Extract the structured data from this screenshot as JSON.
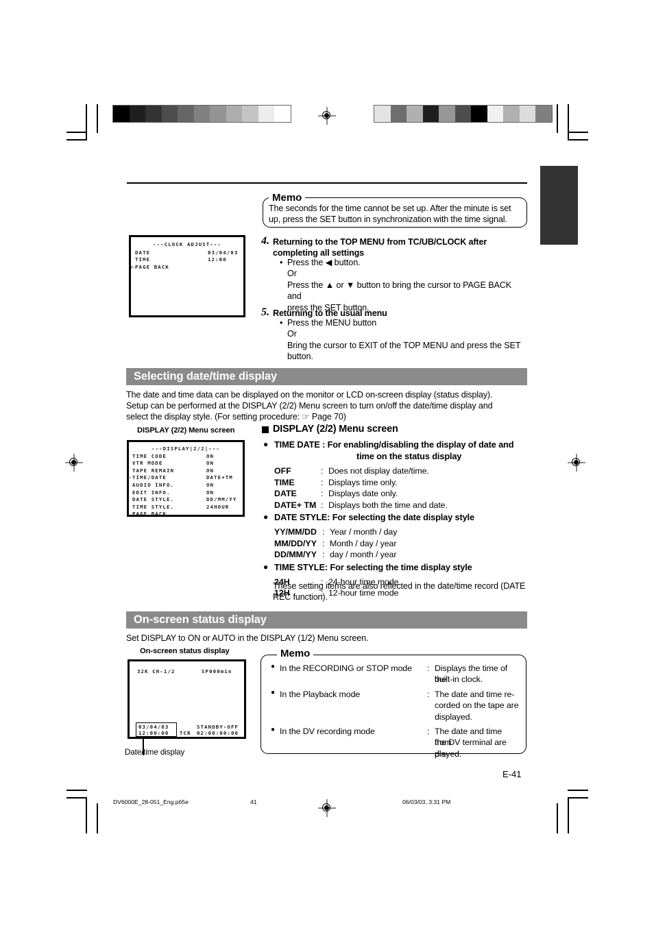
{
  "document": {
    "page_label": "E-41",
    "footer": {
      "filename": "DV6000E_28-051_Eng.p65e",
      "page": "41",
      "timestamp": "06/03/03, 3:31 PM"
    }
  },
  "calibration": {
    "left_bar": [
      "#000000",
      "#1f1f1f",
      "#333333",
      "#4d4d4d",
      "#666666",
      "#808080",
      "#949494",
      "#adadad",
      "#c4c4c4",
      "#ededed",
      "#ffffff"
    ],
    "right_bar": [
      "#e3e3e3",
      "#6e6e6e",
      "#b0b0b0",
      "#1f1f1f",
      "#969696",
      "#4d4d4d",
      "#000000",
      "#f0f0f0",
      "#b0b0b0",
      "#dcdcdc",
      "#808080"
    ]
  },
  "memo_top": {
    "label": "Memo",
    "text": "The seconds for the time cannot be set up. After the minute is set up, press the SET button in synchronization with the time signal."
  },
  "clock_adjust_screen": {
    "title": "---CLOCK ADJUST---",
    "rows": [
      {
        "label": "DATE",
        "value": "03/04/03",
        "cursor": false
      },
      {
        "label": "TIME",
        "value": "12:00",
        "cursor": false
      },
      {
        "label": "PAGE BACK",
        "value": "",
        "cursor": true
      }
    ]
  },
  "steps": [
    {
      "number": "4.",
      "title": "Returning to the TOP MENU from TC/UB/CLOCK after completing all settings",
      "lines": [
        {
          "bullet": true,
          "text": "Press the ◀ button."
        },
        {
          "bullet": false,
          "text": "Or"
        },
        {
          "bullet": false,
          "text": "Press the ▲ or ▼ button to bring the cursor to PAGE BACK and"
        },
        {
          "bullet": false,
          "text": "press the SET button."
        }
      ]
    },
    {
      "number": "5.",
      "title": "Returning to the usual menu",
      "lines": [
        {
          "bullet": true,
          "text": "Press the MENU button"
        },
        {
          "bullet": false,
          "text": "Or"
        },
        {
          "bullet": false,
          "text": "Bring the cursor to EXIT of the TOP MENU and press the SET"
        },
        {
          "bullet": false,
          "text": "button."
        }
      ]
    }
  ],
  "section_date_time": {
    "heading": "Selecting date/time display",
    "intro_lines": [
      "The date and time data can be displayed on the monitor or LCD on-screen display (status display).",
      "Setup can be performed at the DISPLAY (2/2) Menu screen to turn on/off the date/time display and",
      "select the display style. (For setting procedure: ☞ Page 70)"
    ],
    "screen_caption": "DISPLAY (2/2) Menu screen",
    "display_screen": {
      "title": "---DISPLAY|2/2|---",
      "rows": [
        {
          "label": "TIME CODE",
          "value": "ON",
          "cursor": false
        },
        {
          "label": "VTR MODE",
          "value": "ON",
          "cursor": false
        },
        {
          "label": "TAPE REMAIN",
          "value": "ON",
          "cursor": false
        },
        {
          "label": "TIME/DATE",
          "value": "DATE+TM",
          "cursor": true
        },
        {
          "label": "AUDIO INFO.",
          "value": "ON",
          "cursor": false
        },
        {
          "label": "EDIT INFO.",
          "value": "ON",
          "cursor": false
        },
        {
          "label": "DATE STYLE.",
          "value": "DD/MM/YY",
          "cursor": false
        },
        {
          "label": "TIME STYLE.",
          "value": "24HOUR",
          "cursor": false
        },
        {
          "label": "PAGE BACK",
          "value": "",
          "cursor": false
        }
      ]
    },
    "right_heading": "DISPLAY (2/2) Menu screen",
    "groups": [
      {
        "title_line1": "TIME DATE : For enabling/disabling the display of date and",
        "title_line2": "time on the status display",
        "options": [
          {
            "key": "OFF",
            "desc": "Does not display date/time."
          },
          {
            "key": "TIME",
            "desc": "Displays time only."
          },
          {
            "key": "DATE",
            "desc": "Displays date only."
          },
          {
            "key": "DATE+ TM",
            "desc": "Displays both the time and date."
          }
        ]
      },
      {
        "title_line1": "DATE STYLE: For selecting the date display style",
        "title_line2": "",
        "options": [
          {
            "key": "YY/MM/DD",
            "desc": "Year / month / day"
          },
          {
            "key": "MM/DD/YY",
            "desc": "Month / day / year"
          },
          {
            "key": "DD/MM/YY",
            "desc": "day / month / year"
          }
        ]
      },
      {
        "title_line1": "TIME STYLE: For selecting the time display style",
        "title_line2": "",
        "options": [
          {
            "key": "24H",
            "desc": "24-hour time mode"
          },
          {
            "key": "12H",
            "desc": "12-hour time mode"
          }
        ]
      }
    ],
    "note_lines": [
      "These setting items are also reflected in the date/time record (DATE",
      "REC function)."
    ]
  },
  "section_status": {
    "heading": "On-screen status display",
    "intro": "Set DISPLAY to ON or AUTO in the DISPLAY (1/2) Menu screen.",
    "screen_caption": "On-screen status display",
    "status_screen": {
      "top_left": "32K CH-1/2",
      "top_right": "SP000min",
      "date": "03/04/03",
      "time": "12:00:00",
      "standby": "STANDBY-OFF",
      "tcr_label": "TCR",
      "tcr_value": "02:00:00:00"
    },
    "leader_label": "Date/time display",
    "memo": {
      "label": "Memo",
      "items": [
        {
          "mode": "In the RECORDING or STOP mode",
          "desc_lines": [
            "Displays the time of the",
            "built-in clock."
          ]
        },
        {
          "mode": "In the Playback mode",
          "desc_lines": [
            "The date and time re-",
            "corded on the tape are",
            "displayed."
          ]
        },
        {
          "mode": "In the DV recording mode",
          "desc_lines": [
            "The date and time from",
            "the DV terminal are dis-",
            "played."
          ]
        }
      ]
    }
  }
}
